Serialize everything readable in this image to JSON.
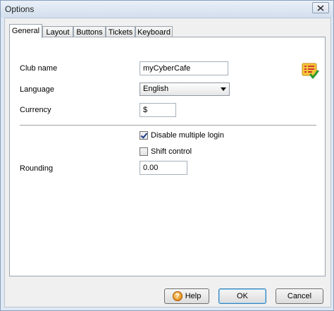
{
  "window": {
    "title": "Options"
  },
  "tabs": [
    {
      "label": "General",
      "active": true
    },
    {
      "label": "Layout",
      "active": false
    },
    {
      "label": "Buttons",
      "active": false
    },
    {
      "label": "Tickets",
      "active": false
    },
    {
      "label": "Keyboard",
      "active": false
    }
  ],
  "general": {
    "club_name_label": "Club name",
    "club_name_value": "myCyberCafe",
    "language_label": "Language",
    "language_value": "English",
    "currency_label": "Currency",
    "currency_value": "$",
    "disable_multiple_login_label": "Disable multiple login",
    "disable_multiple_login_checked": true,
    "shift_control_label": "Shift control",
    "shift_control_checked": false,
    "rounding_label": "Rounding",
    "rounding_value": "0.00"
  },
  "buttons": {
    "help": "Help",
    "ok": "OK",
    "cancel": "Cancel"
  },
  "icons": {
    "close": "close-icon",
    "settings": "settings-checklist-icon",
    "help": "help-icon"
  }
}
